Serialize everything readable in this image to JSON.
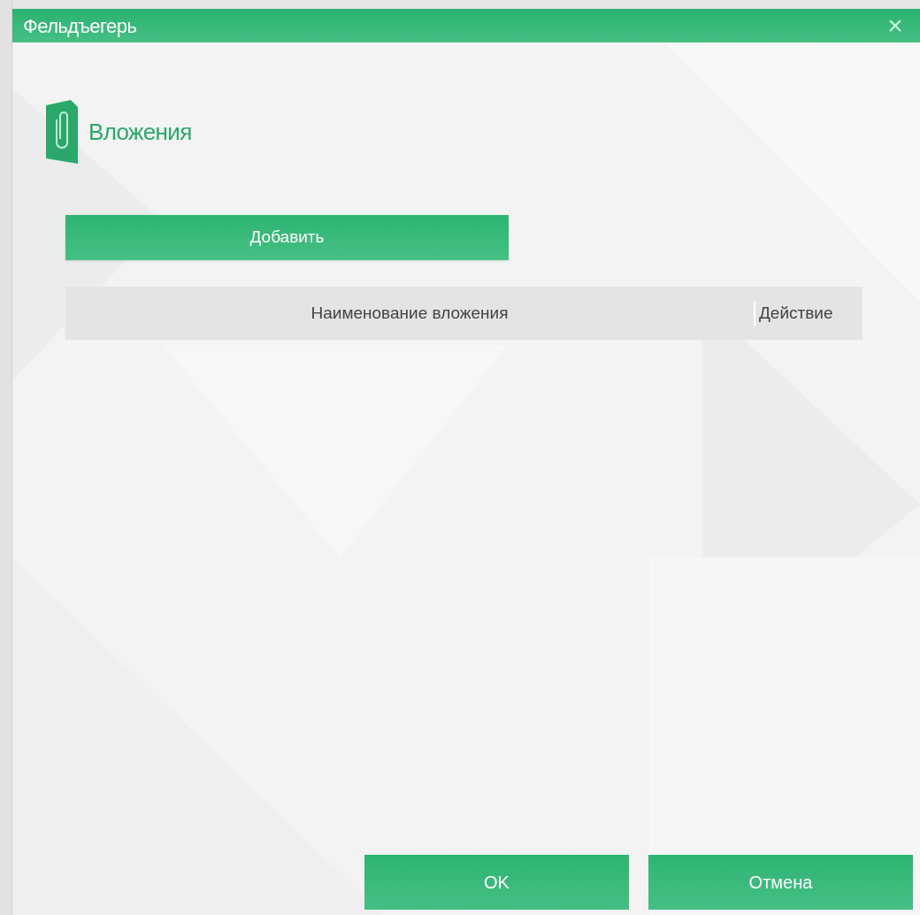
{
  "window": {
    "title": "Фельдъегерь",
    "close": "×"
  },
  "section": {
    "title": "Вложения"
  },
  "add_button": "Добавить",
  "table": {
    "columns": [
      "Наименование вложения",
      "Действие"
    ]
  },
  "buttons": [
    "OK",
    "Отмена"
  ]
}
